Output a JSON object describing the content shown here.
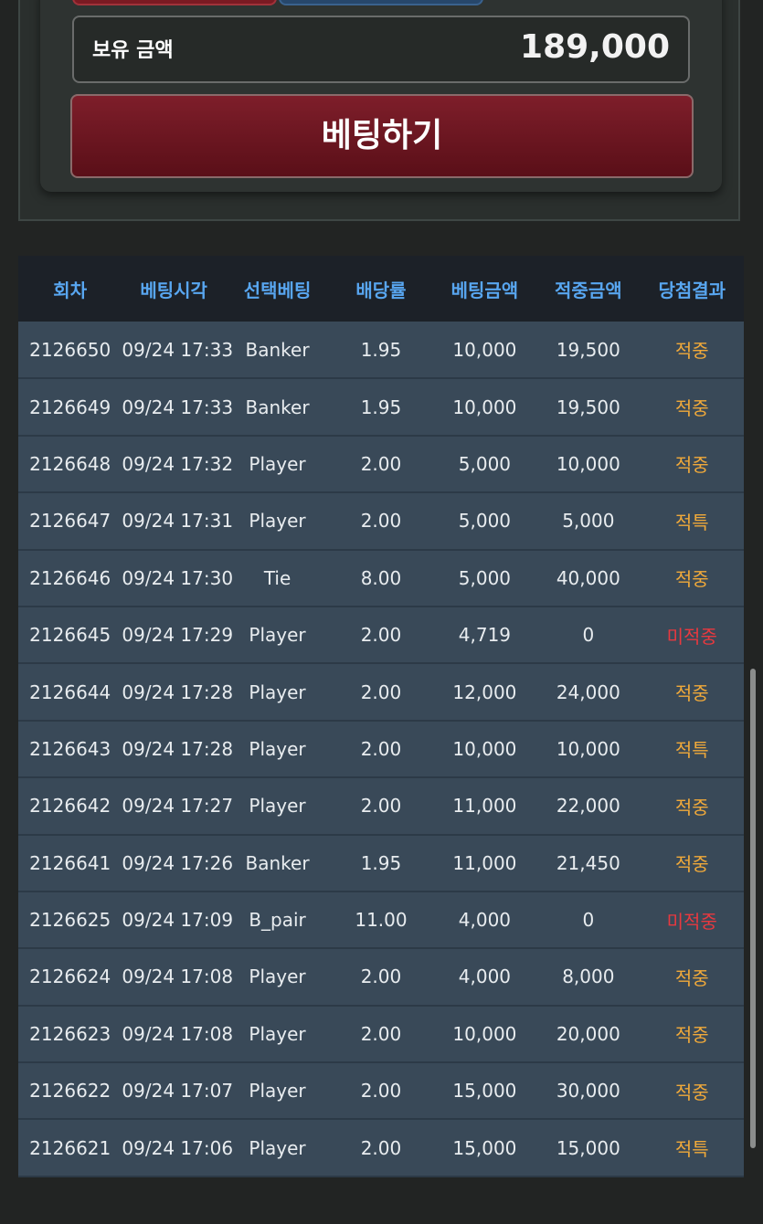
{
  "balance": {
    "label": "보유 금액",
    "value": "189,000"
  },
  "bet_button_label": "베팅하기",
  "table": {
    "headers": [
      "회차",
      "베팅시각",
      "선택베팅",
      "배당률",
      "베팅금액",
      "적중금액",
      "당첨결과"
    ],
    "rows": [
      [
        "2126650",
        "09/24 17:33",
        "Banker",
        "1.95",
        "10,000",
        "19,500",
        "적중"
      ],
      [
        "2126649",
        "09/24 17:33",
        "Banker",
        "1.95",
        "10,000",
        "19,500",
        "적중"
      ],
      [
        "2126648",
        "09/24 17:32",
        "Player",
        "2.00",
        "5,000",
        "10,000",
        "적중"
      ],
      [
        "2126647",
        "09/24 17:31",
        "Player",
        "2.00",
        "5,000",
        "5,000",
        "적특"
      ],
      [
        "2126646",
        "09/24 17:30",
        "Tie",
        "8.00",
        "5,000",
        "40,000",
        "적중"
      ],
      [
        "2126645",
        "09/24 17:29",
        "Player",
        "2.00",
        "4,719",
        "0",
        "미적중"
      ],
      [
        "2126644",
        "09/24 17:28",
        "Player",
        "2.00",
        "12,000",
        "24,000",
        "적중"
      ],
      [
        "2126643",
        "09/24 17:28",
        "Player",
        "2.00",
        "10,000",
        "10,000",
        "적특"
      ],
      [
        "2126642",
        "09/24 17:27",
        "Player",
        "2.00",
        "11,000",
        "22,000",
        "적중"
      ],
      [
        "2126641",
        "09/24 17:26",
        "Banker",
        "1.95",
        "11,000",
        "21,450",
        "적중"
      ],
      [
        "2126625",
        "09/24 17:09",
        "B_pair",
        "11.00",
        "4,000",
        "0",
        "미적중"
      ],
      [
        "2126624",
        "09/24 17:08",
        "Player",
        "2.00",
        "4,000",
        "8,000",
        "적중"
      ],
      [
        "2126623",
        "09/24 17:08",
        "Player",
        "2.00",
        "10,000",
        "20,000",
        "적중"
      ],
      [
        "2126622",
        "09/24 17:07",
        "Player",
        "2.00",
        "15,000",
        "30,000",
        "적중"
      ],
      [
        "2126621",
        "09/24 17:06",
        "Player",
        "2.00",
        "15,000",
        "15,000",
        "적특"
      ]
    ]
  },
  "colors": {
    "result_hit": "#f0a93a",
    "result_miss": "#e8393f",
    "header_text": "#58a6f0"
  }
}
